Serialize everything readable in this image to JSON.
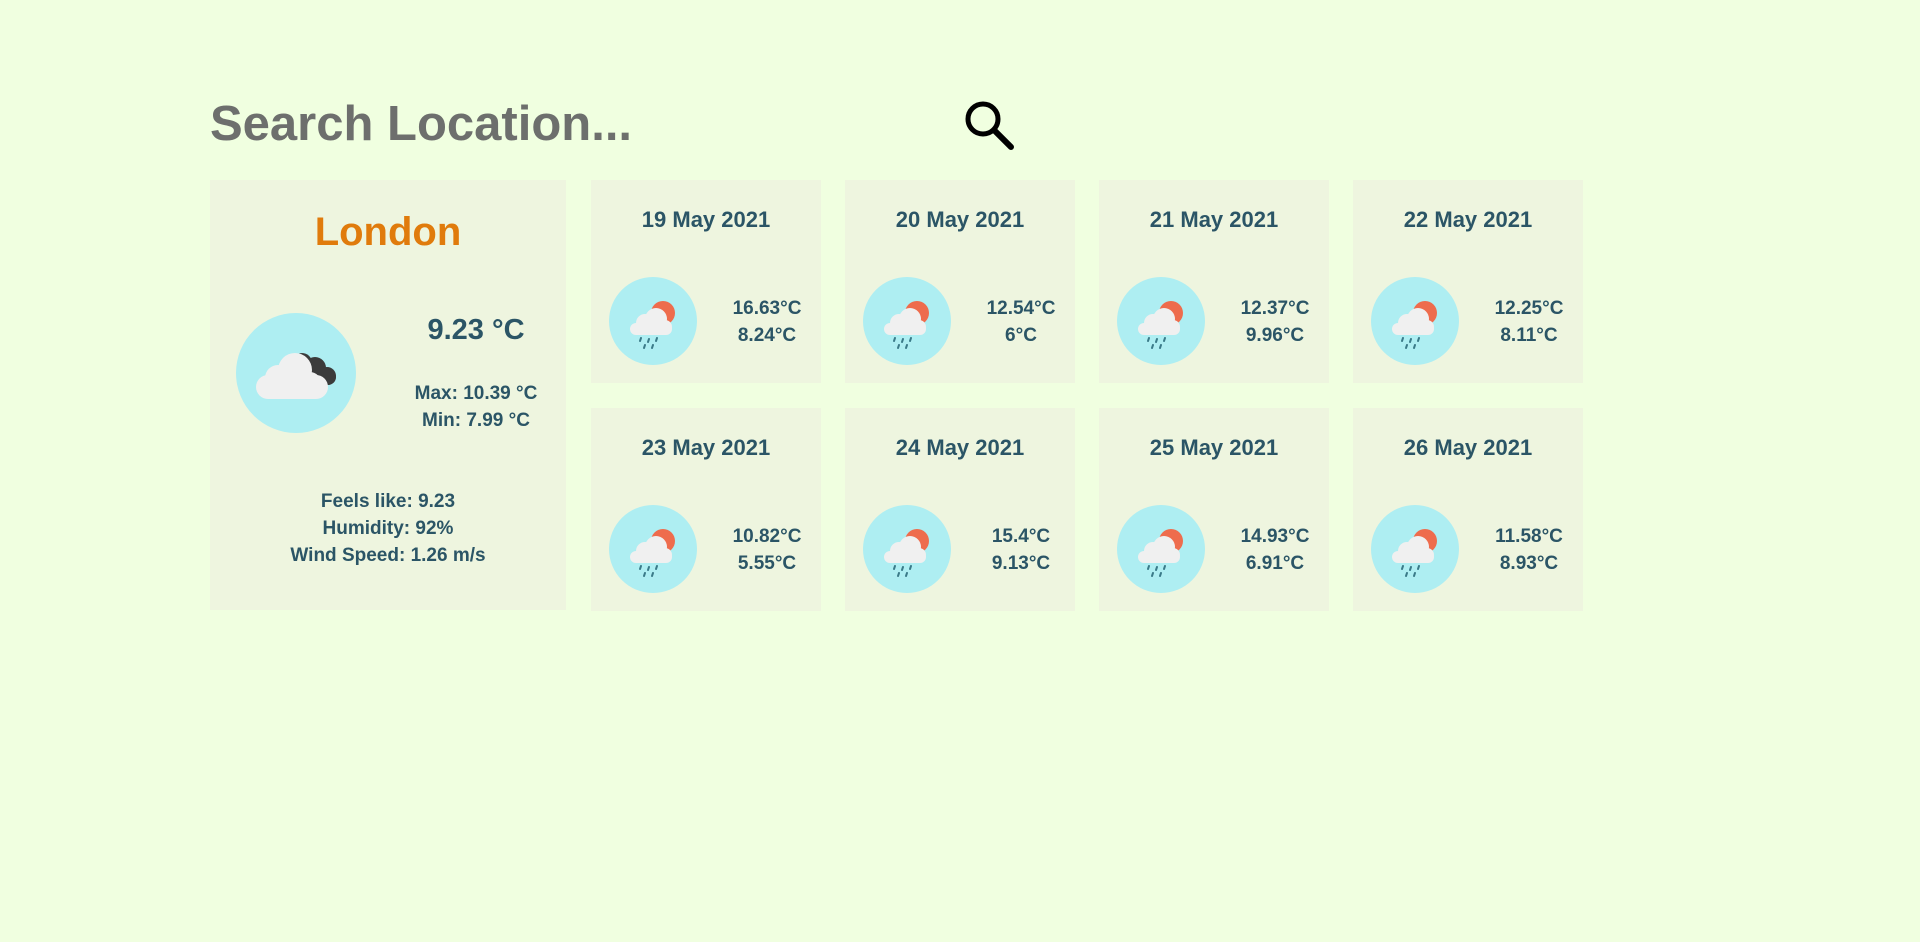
{
  "search": {
    "placeholder": "Search Location...",
    "icon": "search-icon"
  },
  "current": {
    "city": "London",
    "temp": "9.23 °C",
    "max": "Max: 10.39 °C",
    "min": "Min: 7.99 °C",
    "feels_like": "Feels like: 9.23",
    "humidity": "Humidity: 92%",
    "wind_speed": "Wind Speed: 1.26 m/s",
    "icon": "cloudy-icon"
  },
  "forecast": [
    {
      "date": "19 May 2021",
      "max": "16.63°C",
      "min": "8.24°C",
      "icon": "rain-sun-icon"
    },
    {
      "date": "20 May 2021",
      "max": "12.54°C",
      "min": "6°C",
      "icon": "rain-sun-icon"
    },
    {
      "date": "21 May 2021",
      "max": "12.37°C",
      "min": "9.96°C",
      "icon": "rain-sun-icon"
    },
    {
      "date": "22 May 2021",
      "max": "12.25°C",
      "min": "8.11°C",
      "icon": "rain-sun-icon"
    },
    {
      "date": "23 May 2021",
      "max": "10.82°C",
      "min": "5.55°C",
      "icon": "rain-sun-icon"
    },
    {
      "date": "24 May 2021",
      "max": "15.4°C",
      "min": "9.13°C",
      "icon": "rain-sun-icon"
    },
    {
      "date": "25 May 2021",
      "max": "14.93°C",
      "min": "6.91°C",
      "icon": "rain-sun-icon"
    },
    {
      "date": "26 May 2021",
      "max": "11.58°C",
      "min": "8.93°C",
      "icon": "rain-sun-icon"
    }
  ],
  "colors": {
    "background": "#f0ffe0",
    "card": "#eef5df",
    "city": "#e07b0c",
    "text": "#2b5566",
    "icon_circle": "#aeeef2"
  }
}
